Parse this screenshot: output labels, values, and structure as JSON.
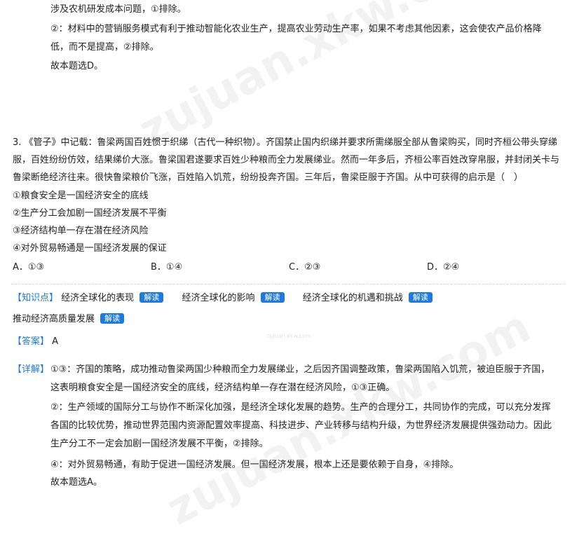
{
  "watermark": {
    "text": "zujuan.xkw.com",
    "small": "zujuan.xkw.com"
  },
  "prev": {
    "line1": "涉及农机研发成本问题，①排除。",
    "line2": "②：材料中的营销服务模式有利于推动智能化农业生产，提高农业劳动生产率，如果不考虑其他因素，这会使农产品价格降",
    "line3": "低，而不是提高，②排除。",
    "line4": "故本题选D。"
  },
  "question": {
    "lines": [
      "3. 《管子》中记载：鲁梁两国百姓惯于织绨（古代一种织物）。齐国禁止国内织绨并要求所需绨服全部从鲁梁购买，同时齐桓公带头穿绨",
      "服，百姓纷纷仿效，结果绨价大涨。鲁梁国君遂要求百姓少种粮而全力发展绨业。然而一年多后，齐桓公率百姓改穿帛服，并封闭关卡与",
      "鲁梁断绝经济往来。很快鲁梁粮价飞涨，百姓陷入饥荒，纷纷投奔齐国。三年后，鲁梁臣服于齐国。从中可获得的启示是（　）"
    ],
    "statements": [
      "①粮食安全是一国经济安全的底线",
      "②生产分工会加剧一国经济发展不平衡",
      "③经济结构单一存在潜在经济风险",
      "④对外贸易畅通是一国经济发展的保证"
    ],
    "options": [
      "A．①③",
      "B．①④",
      "C．②③",
      "D．②④"
    ]
  },
  "knowledge": {
    "tag": "【知识点】",
    "badge": "解读",
    "items": [
      "经济全球化的表现",
      "经济全球化的影响",
      "经济全球化的机遇和挑战",
      "推动经济高质量发展"
    ]
  },
  "answer": {
    "tag": "【答案】",
    "value": "A"
  },
  "detail": {
    "tag": "【详解】",
    "lines": [
      "①③：齐国的策略，成功推动鲁梁两国少种粮而全力发展绨业，之后因齐国调整政策，鲁梁两国陷入饥荒，被迫臣服于齐国，",
      "这表明粮食安全是一国经济安全的底线，经济结构单一存在潜在经济风险，①③正确。",
      "②：生产领域的国际分工与协作不断深化加强，是经济全球化发展的趋势。生产的合理分工，共同协作的完成，可以充分发挥",
      "各国的比较优势，推动世界范围内资源配置效率提高、科技进步、产业转移与结构升级，为世界经济发展提供强劲动力。因此",
      "生产分工不一定会加剧一国经济发展不平衡，②排除。",
      "④：对外贸易畅通，有助于促进一国经济发展。但一国经济发展，根本上还是要依赖于自身，④排除。",
      "故本题选A。"
    ]
  }
}
